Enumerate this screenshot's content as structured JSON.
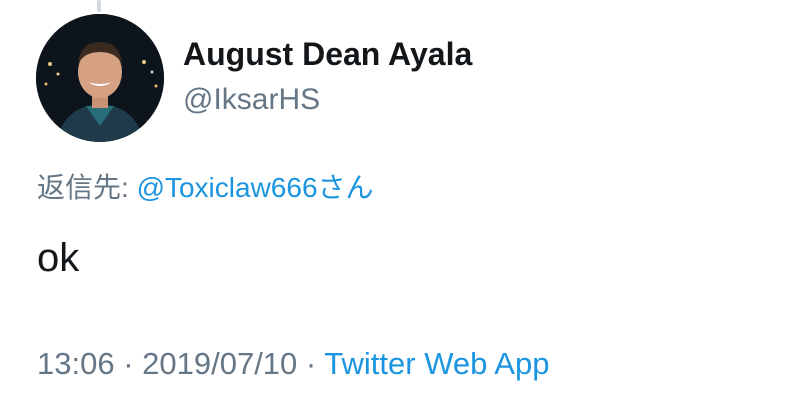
{
  "tweet": {
    "author": {
      "display_name": "August Dean Ayala",
      "handle": "@IksarHS",
      "avatar_icon": "user-avatar-photo"
    },
    "reply": {
      "prefix": "返信先: ",
      "target": "@Toxiclaw666さん"
    },
    "text": "ok",
    "meta": {
      "time": "13:06",
      "separator": " · ",
      "date": "2019/07/10",
      "source": "Twitter Web App"
    }
  },
  "colors": {
    "text": "#14171a",
    "secondary": "#657786",
    "link": "#1b95e0",
    "background": "#ffffff"
  }
}
